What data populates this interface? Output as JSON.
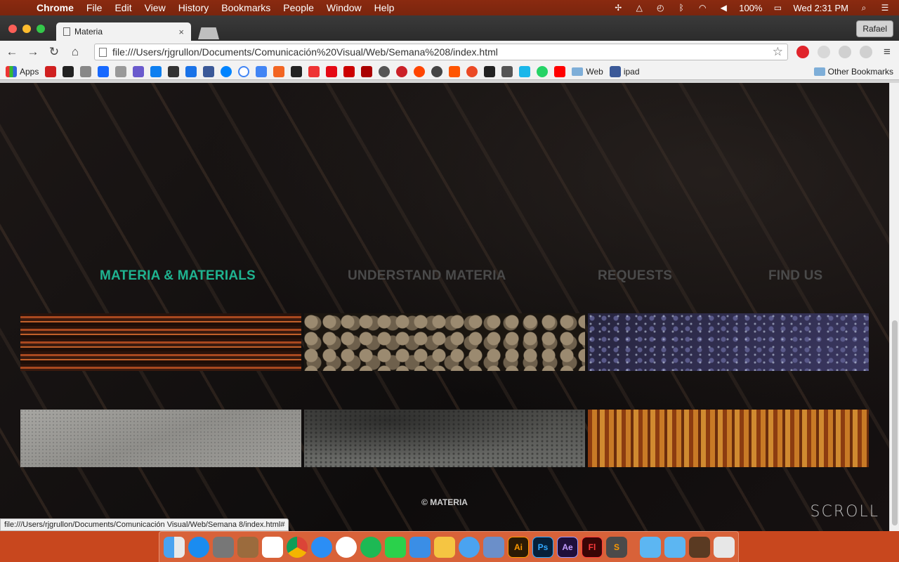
{
  "menubar": {
    "app": "Chrome",
    "items": [
      "File",
      "Edit",
      "View",
      "History",
      "Bookmarks",
      "People",
      "Window",
      "Help"
    ],
    "battery": "100%",
    "clock": "Wed 2:31 PM"
  },
  "browser": {
    "tab_title": "Materia",
    "tab_close": "×",
    "profile": "Rafael",
    "url": "file:///Users/rjgrullon/Documents/Comunicación%20Visual/Web/Semana%208/index.html",
    "bookmarks": {
      "apps": "Apps",
      "web_folder": "Web",
      "ipad": "ipad",
      "other": "Other Bookmarks"
    }
  },
  "page": {
    "nav": [
      {
        "label": "MATERIA & MATERIALS",
        "active": true
      },
      {
        "label": "UNDERSTAND MATERIA",
        "active": false
      },
      {
        "label": "REQUESTS",
        "active": false
      },
      {
        "label": "FIND US",
        "active": false
      }
    ],
    "tiles": [
      "wood",
      "logs",
      "granite",
      "stone",
      "concrete",
      "rust"
    ],
    "copyright": "© MATERIA",
    "scroll_logo": "SCROLL"
  },
  "status_url": "file:///Users/rjgrullon/Documents/Comunicación Visual/Web/Semana 8/index.html#",
  "colors": {
    "nav_active": "#1fb390",
    "nav_inactive": "#4a4a4a"
  }
}
